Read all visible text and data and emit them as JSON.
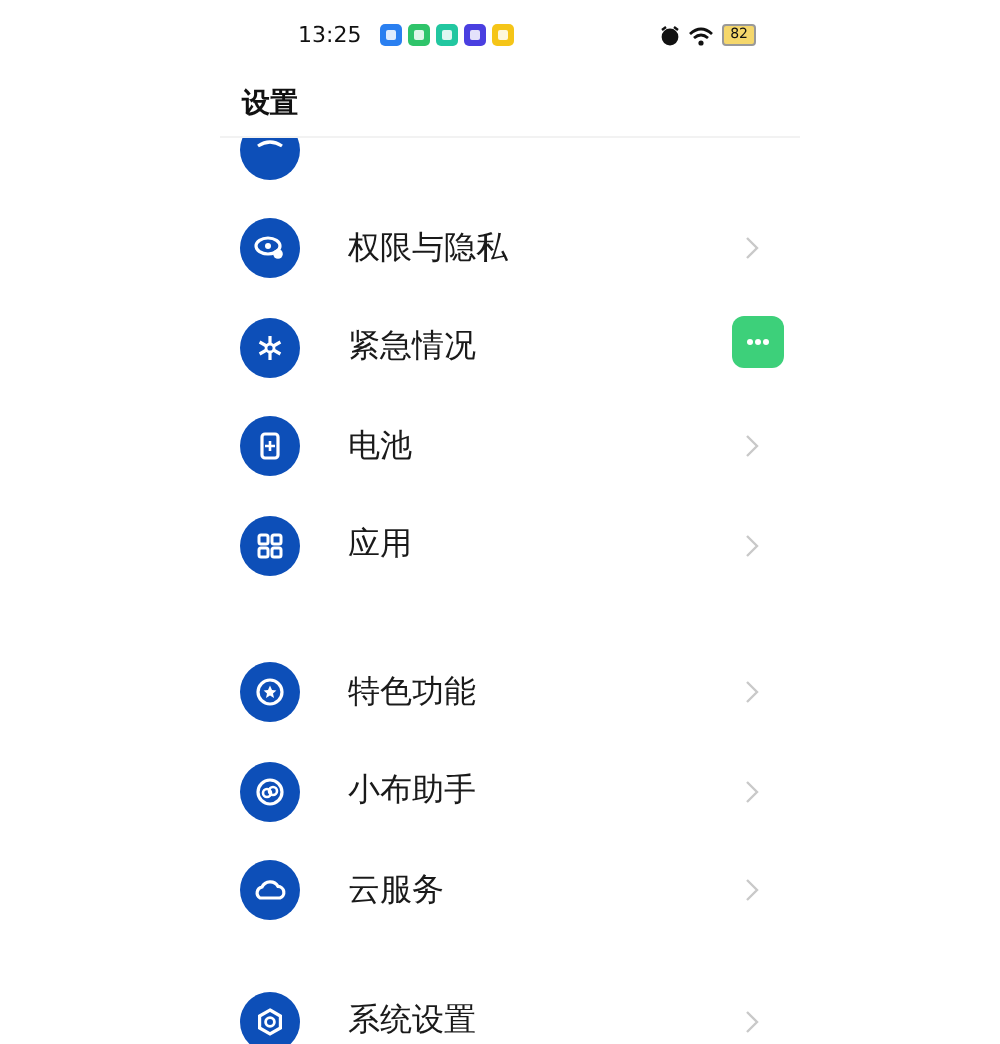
{
  "status_bar": {
    "time": "13:25",
    "app_icons": [
      {
        "color": "#2a7ff0"
      },
      {
        "color": "#2fc46a"
      },
      {
        "color": "#22c7a0"
      },
      {
        "color": "#4a3fe0"
      },
      {
        "color": "#f5c518"
      }
    ],
    "battery": "82"
  },
  "header": {
    "title": "设置"
  },
  "sections": [
    {
      "items": [
        {
          "kind": "cut"
        },
        {
          "kind": "item",
          "label": "权限与隐私"
        },
        {
          "kind": "item",
          "label": "紧急情况",
          "chevron_hidden": true
        },
        {
          "kind": "item",
          "label": "电池"
        },
        {
          "kind": "item",
          "label": "应用"
        }
      ]
    },
    {
      "items": [
        {
          "kind": "item",
          "label": "特色功能"
        },
        {
          "kind": "item",
          "label": "小布助手"
        },
        {
          "kind": "item",
          "label": "云服务"
        }
      ]
    },
    {
      "items": [
        {
          "kind": "item",
          "label": "系统设置"
        }
      ]
    }
  ],
  "floating_button": {
    "color": "#3dd07a"
  }
}
